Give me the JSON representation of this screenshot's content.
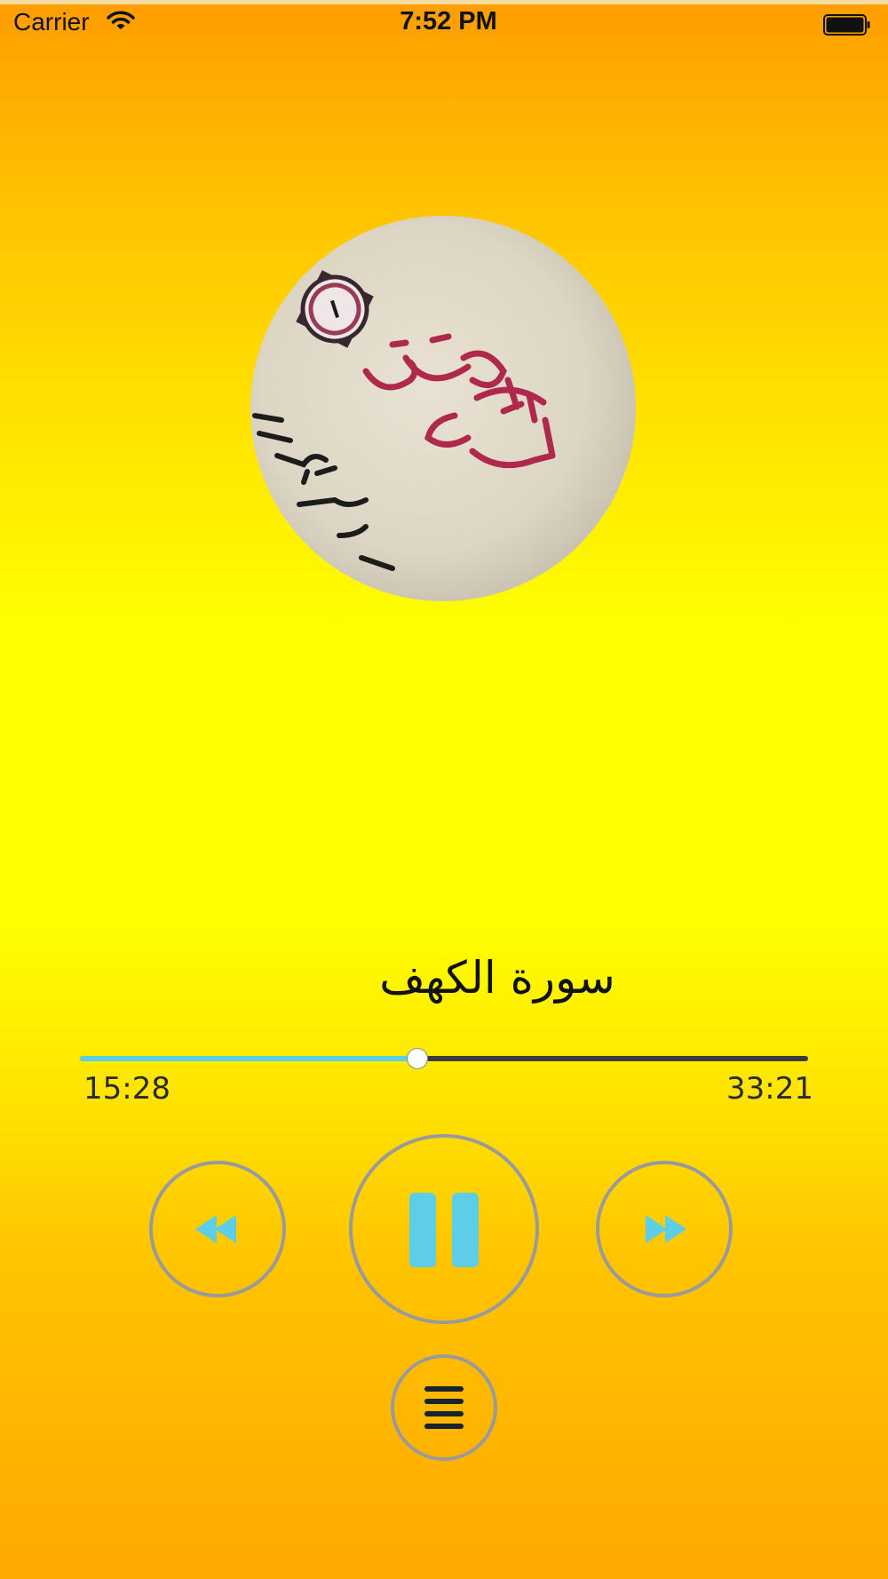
{
  "status_bar": {
    "carrier": "Carrier",
    "time": "7:52 PM"
  },
  "player": {
    "track_title": "سورة الكهف",
    "elapsed": "15:28",
    "total": "33:21",
    "progress_fraction": 0.464
  },
  "controls": {
    "rewind_icon": "rewind-icon",
    "play_pause_icon": "pause-icon",
    "forward_icon": "fast-forward-icon",
    "menu_icon": "menu-icon"
  },
  "colors": {
    "accent": "#5ccfe6",
    "track": "#3b3b3b",
    "ring": "#9a9a9a",
    "gradient_top": "#ff9c00",
    "gradient_middle": "#ffff00",
    "gradient_bottom": "#ffa800"
  }
}
